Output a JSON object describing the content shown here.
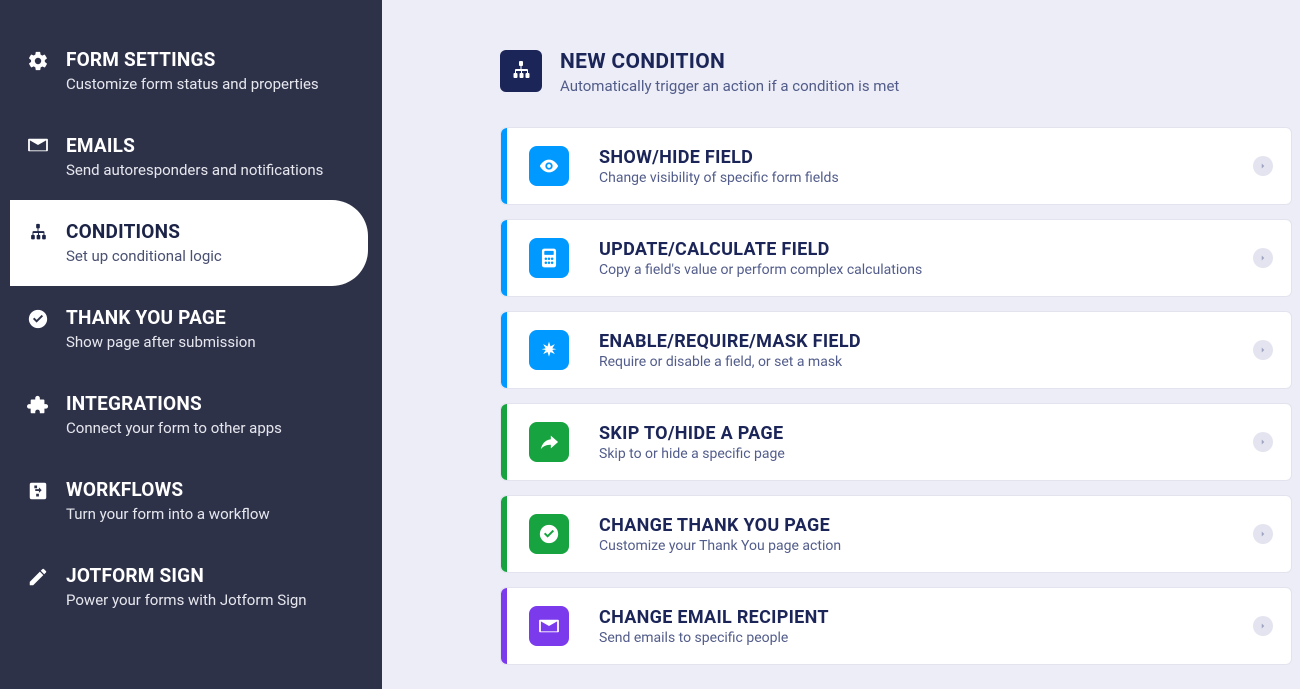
{
  "sidebar": {
    "items": [
      {
        "title": "FORM SETTINGS",
        "desc": "Customize form status and properties"
      },
      {
        "title": "EMAILS",
        "desc": "Send autoresponders and notifications"
      },
      {
        "title": "CONDITIONS",
        "desc": "Set up conditional logic"
      },
      {
        "title": "THANK YOU PAGE",
        "desc": "Show page after submission"
      },
      {
        "title": "INTEGRATIONS",
        "desc": "Connect your form to other apps"
      },
      {
        "title": "WORKFLOWS",
        "desc": "Turn your form into a workflow"
      },
      {
        "title": "JOTFORM SIGN",
        "desc": "Power your forms with Jotform Sign"
      }
    ]
  },
  "header": {
    "title": "NEW CONDITION",
    "desc": "Automatically trigger an action if a condition is met"
  },
  "cards": [
    {
      "title": "SHOW/HIDE FIELD",
      "desc": "Change visibility of specific form fields"
    },
    {
      "title": "UPDATE/CALCULATE FIELD",
      "desc": "Copy a field's value or perform complex calculations"
    },
    {
      "title": "ENABLE/REQUIRE/MASK FIELD",
      "desc": "Require or disable a field, or set a mask"
    },
    {
      "title": "SKIP TO/HIDE A PAGE",
      "desc": "Skip to or hide a specific page"
    },
    {
      "title": "CHANGE THANK YOU PAGE",
      "desc": "Customize your Thank You page action"
    },
    {
      "title": "CHANGE EMAIL RECIPIENT",
      "desc": "Send emails to specific people"
    }
  ]
}
